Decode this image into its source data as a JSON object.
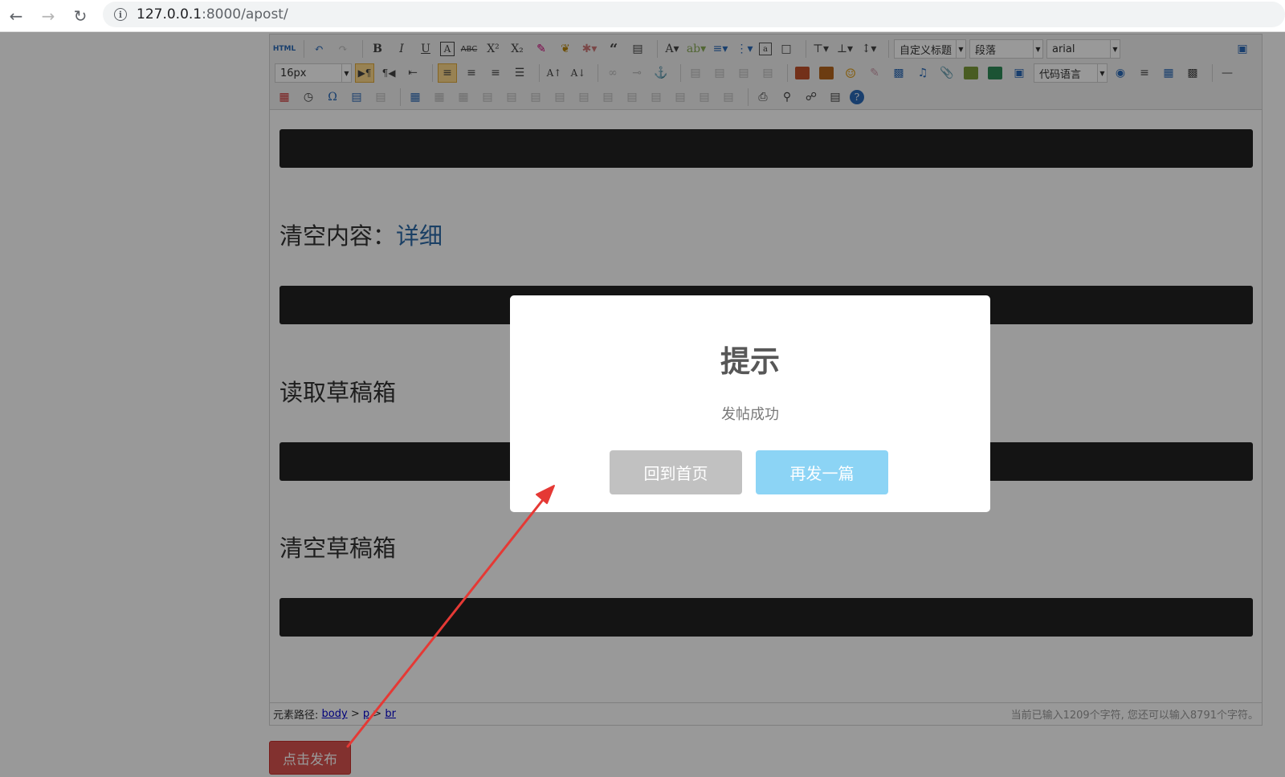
{
  "browser": {
    "url_host": "127.0.0.1",
    "url_path": ":8000/apost/"
  },
  "toolbar": {
    "font_size_value": "16px",
    "custom_heading_value": "自定义标题",
    "paragraph_value": "段落",
    "font_family_value": "arial",
    "code_language_value": "代码语言"
  },
  "content": {
    "heading_clear_label": "清空内容：",
    "heading_clear_link": "详细",
    "heading_read_draft": "读取草稿箱",
    "heading_clear_draft": "清空草稿箱"
  },
  "statusbar": {
    "path_label": "元素路径:",
    "path_body": "body",
    "path_p": "p",
    "path_br": "br",
    "sep": ">",
    "char_count": "当前已输入1209个字符, 您还可以输入8791个字符。"
  },
  "publish_button": "点击发布",
  "dialog": {
    "title": "提示",
    "message": "发帖成功",
    "home_button": "回到首页",
    "again_button": "再发一篇"
  },
  "colors": {
    "accent_publish": "#d9534f",
    "dialog_confirm": "#8cd4f5",
    "dialog_cancel": "#c1c1c1",
    "annotation_arrow": "#e53935"
  }
}
